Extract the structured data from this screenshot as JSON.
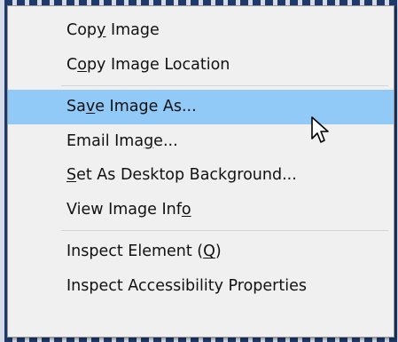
{
  "menu": {
    "items": [
      {
        "pre": "Cop",
        "u": "y",
        "post": " Image"
      },
      {
        "pre": "C",
        "u": "o",
        "post": "py Image Location"
      },
      {
        "pre": "Sa",
        "u": "v",
        "post": "e Image As..."
      },
      {
        "pre": "Email Ima",
        "u": "g",
        "post": "e..."
      },
      {
        "pre": "",
        "u": "S",
        "post": "et As Desktop Background..."
      },
      {
        "pre": "View Image Inf",
        "u": "o",
        "post": ""
      },
      {
        "pre": "Inspect Element (",
        "u": "Q",
        "post": ")"
      },
      {
        "pre": "Inspect Accessibility Properties",
        "u": "",
        "post": ""
      }
    ],
    "highlight_color": "#91c9f7",
    "background_color": "#f0f0f0"
  },
  "cursor": {
    "icon": "arrow-cursor-icon"
  }
}
